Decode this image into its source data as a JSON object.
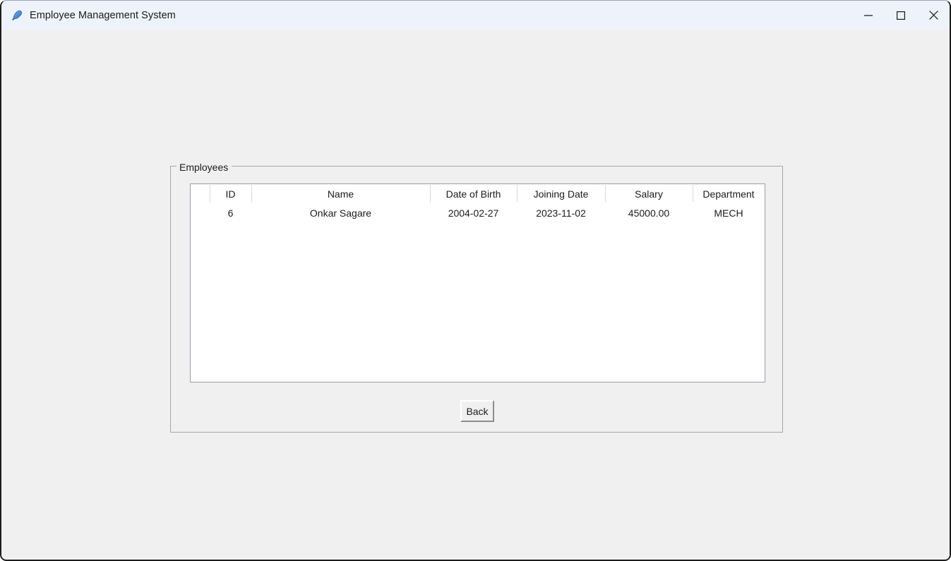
{
  "window": {
    "title": "Employee Management System",
    "icon": "feather-icon",
    "background": "#f0f0f0",
    "titlebar_background": "#eef2fa",
    "controls": [
      {
        "name": "minimize-button",
        "icon": "minimize-icon",
        "label": "Minimize"
      },
      {
        "name": "maximize-button",
        "icon": "maximize-icon",
        "label": "Maximize"
      },
      {
        "name": "close-button",
        "icon": "close-icon",
        "label": "Close"
      }
    ]
  },
  "employees_group": {
    "legend": "Employees"
  },
  "table": {
    "columns": [
      {
        "key": "tree",
        "label": ""
      },
      {
        "key": "id",
        "label": "ID"
      },
      {
        "key": "name",
        "label": "Name"
      },
      {
        "key": "dob",
        "label": "Date of Birth"
      },
      {
        "key": "joining",
        "label": "Joining Date"
      },
      {
        "key": "salary",
        "label": "Salary"
      },
      {
        "key": "department",
        "label": "Department"
      }
    ],
    "rows": [
      {
        "tree": "",
        "id": "6",
        "name": "Onkar Sagare",
        "dob": "2004-02-27",
        "joining": "2023-11-02",
        "salary": "45000.00",
        "department": "MECH"
      }
    ]
  },
  "actions": {
    "back_label": "Back"
  }
}
